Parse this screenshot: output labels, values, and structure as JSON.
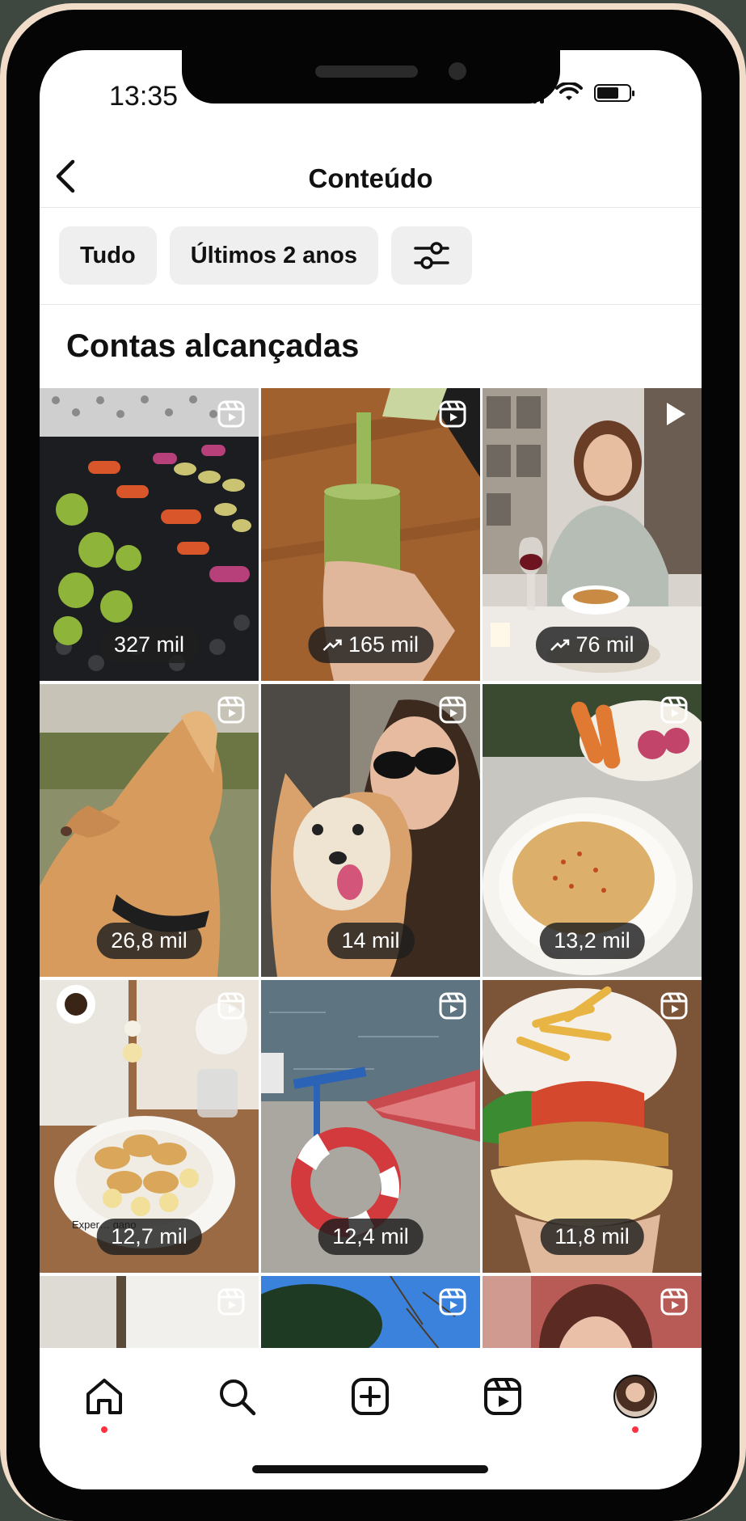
{
  "status_bar": {
    "time": "13:35"
  },
  "header": {
    "back_icon": "chevron-left-icon",
    "title": "Conteúdo"
  },
  "filters": {
    "type_label": "Tudo",
    "period_label": "Últimos 2 anos",
    "settings_icon": "sliders-icon"
  },
  "section": {
    "title": "Contas alcançadas"
  },
  "posts": [
    {
      "metric": "327 mil",
      "trend": false,
      "media": "grilled-vegetables",
      "type_icon": "reels-icon"
    },
    {
      "metric": "165 mil",
      "trend": true,
      "media": "green-smoothie",
      "type_icon": "reels-icon"
    },
    {
      "metric": "76 mil",
      "trend": true,
      "media": "woman-dinner-wine",
      "type_icon": "play-icon"
    },
    {
      "metric": "26,8 mil",
      "trend": false,
      "media": "dog-profile",
      "type_icon": "reels-icon"
    },
    {
      "metric": "14 mil",
      "trend": false,
      "media": "woman-with-dog",
      "type_icon": "reels-icon"
    },
    {
      "metric": "13,2 mil",
      "trend": false,
      "media": "hummus-bowl",
      "type_icon": "reels-icon"
    },
    {
      "metric": "12,7 mil",
      "trend": false,
      "media": "bread-basket-table",
      "type_icon": "reels-icon",
      "caption": "Exper… gano"
    },
    {
      "metric": "12,4 mil",
      "trend": false,
      "media": "lake-lifebuoy-boat",
      "type_icon": "reels-icon"
    },
    {
      "metric": "11,8 mil",
      "trend": false,
      "media": "veggie-burger-fries",
      "type_icon": "reels-icon"
    },
    {
      "metric": "",
      "trend": false,
      "media": "interior-door",
      "type_icon": "reels-icon"
    },
    {
      "metric": "",
      "trend": false,
      "media": "tree-sky",
      "type_icon": "reels-icon"
    },
    {
      "metric": "",
      "trend": false,
      "media": "woman-portrait",
      "type_icon": "reels-icon"
    }
  ],
  "bottom_nav": [
    {
      "icon": "home-icon",
      "active": true
    },
    {
      "icon": "search-icon",
      "active": false
    },
    {
      "icon": "create-post-icon",
      "active": false
    },
    {
      "icon": "reels-icon",
      "active": false
    },
    {
      "icon": "profile-avatar",
      "active": false,
      "notification": true
    }
  ],
  "colors": {
    "notification_dot": "#ff3040",
    "chip_bg": "#efefef",
    "badge_bg": "#1e1e1e"
  }
}
